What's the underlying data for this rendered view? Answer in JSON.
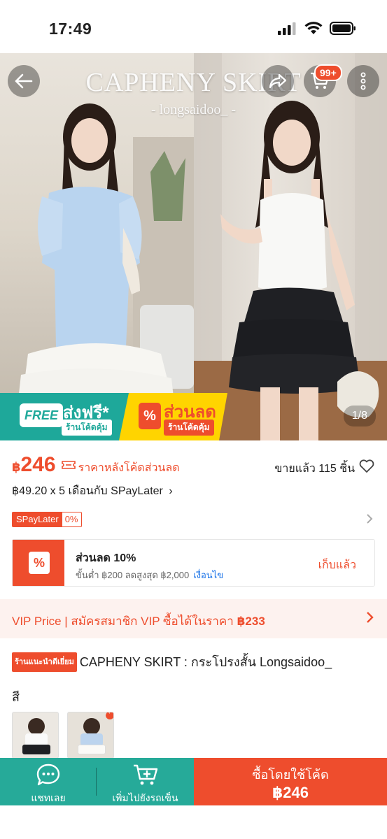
{
  "status_bar": {
    "time": "17:49"
  },
  "hero": {
    "title": "CAPHENY SKIRT",
    "subtitle": "- longsaidoo_ -",
    "cart_badge": "99+",
    "page_indicator": "1/8"
  },
  "promos": {
    "free_shipping": {
      "badge": "FREE",
      "title": "ส่งฟรี*",
      "subtitle": "ร้านโค้ดคุ้ม"
    },
    "discount": {
      "icon": "%",
      "title": "ส่วนลด",
      "subtitle": "ร้านโค้ดคุ้ม"
    }
  },
  "price": {
    "currency": "฿",
    "value": "246",
    "note": "ราคาหลังโค้ดส่วนลด",
    "sold": "ขายแล้ว 115 ชิ้น",
    "installment": "฿49.20 x 5 เดือนกับ SPayLater",
    "installment_chevron": "›",
    "spay_label": "SPayLater",
    "spay_rate": "0%"
  },
  "voucher": {
    "icon": "%",
    "title": "ส่วนลด 10%",
    "condition": "ขั้นต่ำ ฿200 ลดสูงสุด ฿2,000",
    "condition_link": "เงื่อนไข",
    "claim": "เก็บแล้ว"
  },
  "vip": {
    "text": "VIP Price | สมัครสมาชิก VIP ซื้อได้ในราคา ",
    "price": "฿233"
  },
  "product": {
    "shop_tag": "ร้านแนะนำดีเยี่ยม",
    "title": "CAPHENY SKIRT : กระโปรงสั้น Longsaidoo_",
    "option_label": "สี"
  },
  "bottom_bar": {
    "chat_label": "แชทเลย",
    "cart_label": "เพิ่มไปยังรถเข็น",
    "buy_label": "ซื้อโดยใช้โค้ด",
    "buy_price": "฿246"
  },
  "colors": {
    "brand": "#ee4d2d",
    "teal": "#26aa99",
    "free_shipping": "#1ea89a",
    "discount_yellow": "#ffd400",
    "vip_bg": "#fdf2ef"
  }
}
